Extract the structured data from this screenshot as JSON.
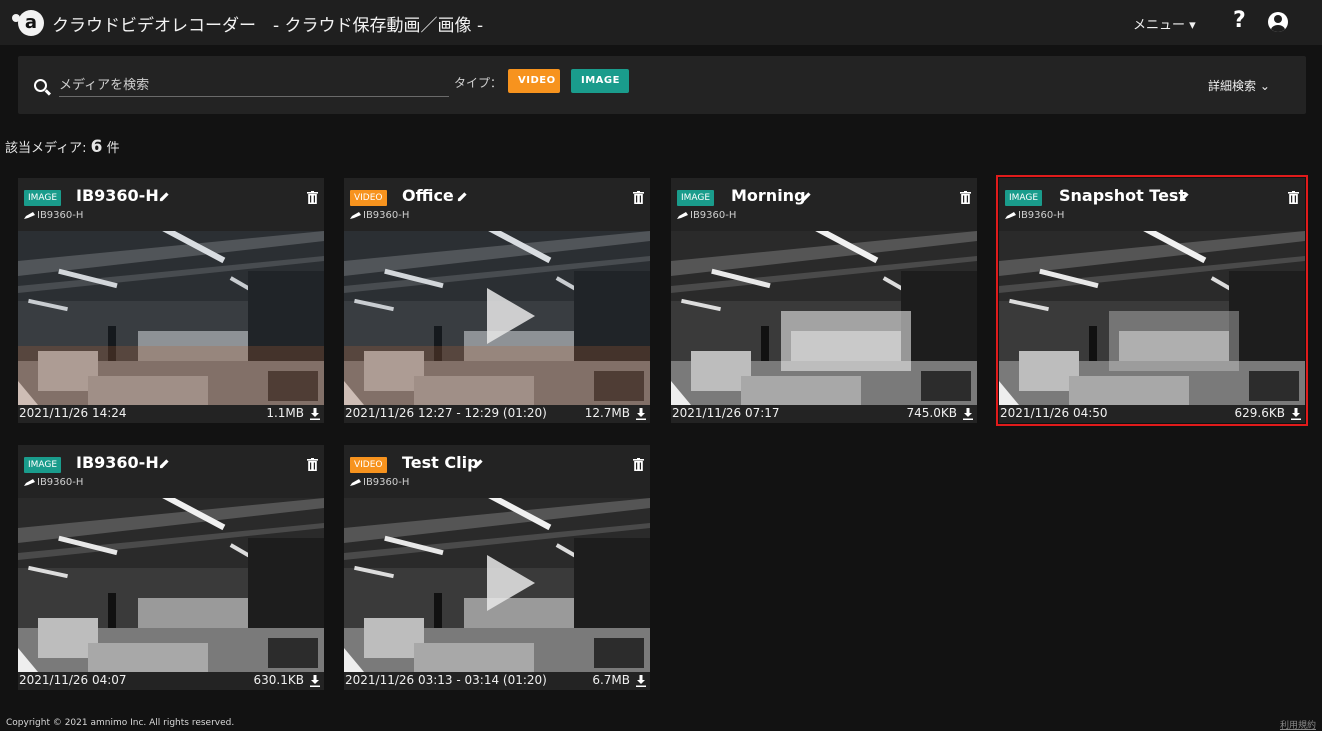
{
  "header": {
    "logo_text": "a",
    "app_title": "クラウドビデオレコーダー　- クラウド保存動画／画像 -",
    "menu_label": "メニュー ▾",
    "help_label": "?"
  },
  "search": {
    "placeholder": "メディアを検索",
    "type_label": "タイプ：",
    "filter_video": "VIDEO",
    "filter_image": "IMAGE",
    "advanced_label": "詳細検索 ⌄"
  },
  "results": {
    "label": "該当メディア:",
    "count": "6",
    "unit": "件"
  },
  "cards": [
    {
      "type": "IMAGE",
      "title": "IB9360-H",
      "camera": "IB9360-H",
      "date": "2021/11/26 14:24",
      "size": "1.1MB"
    },
    {
      "type": "VIDEO",
      "title": "Office",
      "camera": "IB9360-H",
      "date": "2021/11/26 12:27 - 12:29 (01:20)",
      "size": "12.7MB"
    },
    {
      "type": "IMAGE",
      "title": "Morning",
      "camera": "IB9360-H",
      "date": "2021/11/26 07:17",
      "size": "745.0KB"
    },
    {
      "type": "IMAGE",
      "title": "Snapshot Test",
      "camera": "IB9360-H",
      "date": "2021/11/26 04:50",
      "size": "629.6KB"
    },
    {
      "type": "IMAGE",
      "title": "IB9360-H",
      "camera": "IB9360-H",
      "date": "2021/11/26 04:07",
      "size": "630.1KB"
    },
    {
      "type": "VIDEO",
      "title": "Test Clip",
      "camera": "IB9360-H",
      "date": "2021/11/26 03:13 - 03:14 (01:20)",
      "size": "6.7MB"
    }
  ],
  "footer": {
    "copyright": "Copyright © 2021 amnimo Inc. All rights reserved.",
    "terms": "利用規約"
  },
  "colors": {
    "image_badge": "#1a9c8c",
    "video_badge": "#f7931e",
    "selection": "#e01b1b",
    "background": "#121212"
  }
}
